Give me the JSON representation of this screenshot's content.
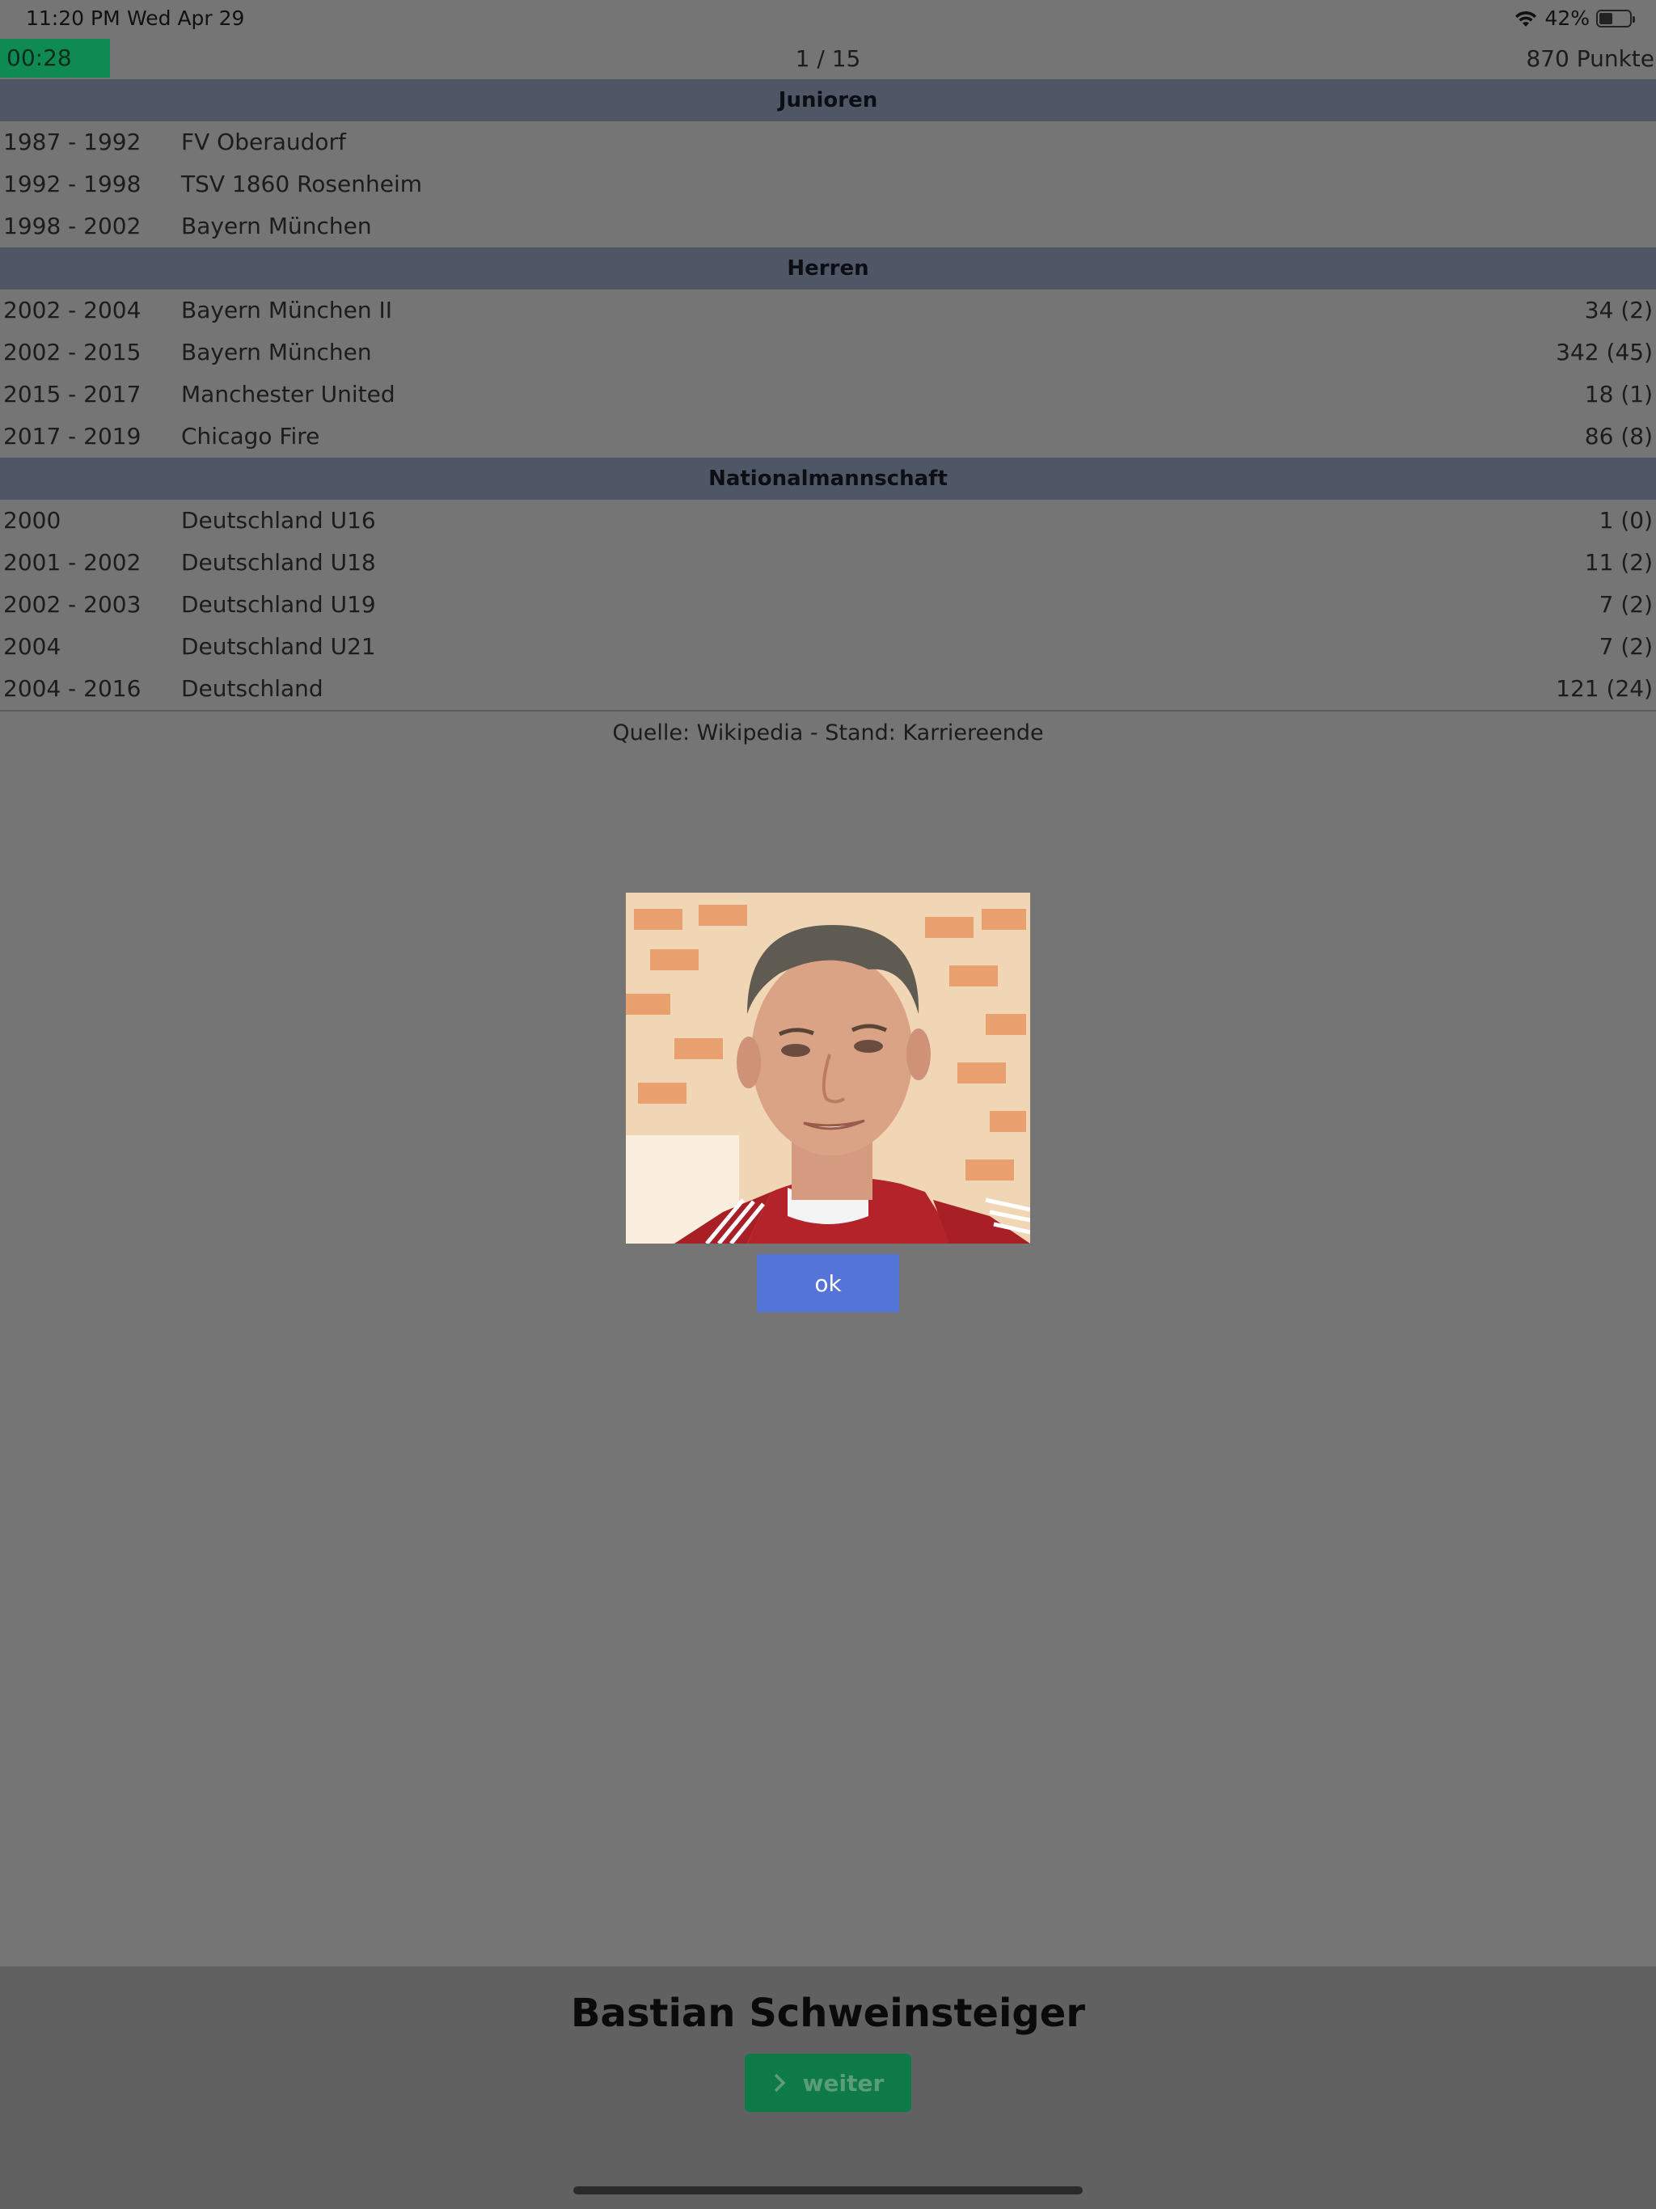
{
  "status_bar": {
    "time": "11:20 PM",
    "date": "Wed Apr 29",
    "battery_text": "42%",
    "battery_level": 0.42,
    "icons": [
      "wifi-icon",
      "battery-icon"
    ]
  },
  "quiz": {
    "timer": "00:28",
    "progress": "1 / 15",
    "points": "870 Punkte",
    "timer_color": "#0f8a52"
  },
  "career": {
    "juniors": {
      "title": "Junioren",
      "rows": [
        {
          "years": "1987 - 1992",
          "club": "FV Oberaudorf",
          "stats": ""
        },
        {
          "years": "1992 - 1998",
          "club": "TSV 1860 Rosenheim",
          "stats": ""
        },
        {
          "years": "1998 - 2002",
          "club": "Bayern München",
          "stats": ""
        }
      ]
    },
    "seniors": {
      "title": "Herren",
      "rows": [
        {
          "years": "2002 - 2004",
          "club": "Bayern München II",
          "stats": "34 (2)"
        },
        {
          "years": "2002 - 2015",
          "club": "Bayern München",
          "stats": "342 (45)"
        },
        {
          "years": "2015 - 2017",
          "club": "Manchester United",
          "stats": "18 (1)"
        },
        {
          "years": "2017 - 2019",
          "club": "Chicago Fire",
          "stats": "86 (8)"
        }
      ]
    },
    "national": {
      "title": "Nationalmannschaft",
      "rows": [
        {
          "years": "2000",
          "club": "Deutschland U16",
          "stats": "1 (0)"
        },
        {
          "years": "2001 - 2002",
          "club": "Deutschland U18",
          "stats": "11 (2)"
        },
        {
          "years": "2002 - 2003",
          "club": "Deutschland U19",
          "stats": "7 (2)"
        },
        {
          "years": "2004",
          "club": "Deutschland U21",
          "stats": "7 (2)"
        },
        {
          "years": "2004 - 2016",
          "club": "Deutschland",
          "stats": "121 (24)"
        }
      ]
    },
    "source": "Quelle: Wikipedia - Stand: Karriereende"
  },
  "dialog": {
    "ok_label": "ok",
    "ok_color": "#5474d8"
  },
  "answer": {
    "player_name": "Bastian Schweinsteiger",
    "next_label": "weiter",
    "next_icon": "chevron-right-icon",
    "next_color": "#0d7a47"
  }
}
